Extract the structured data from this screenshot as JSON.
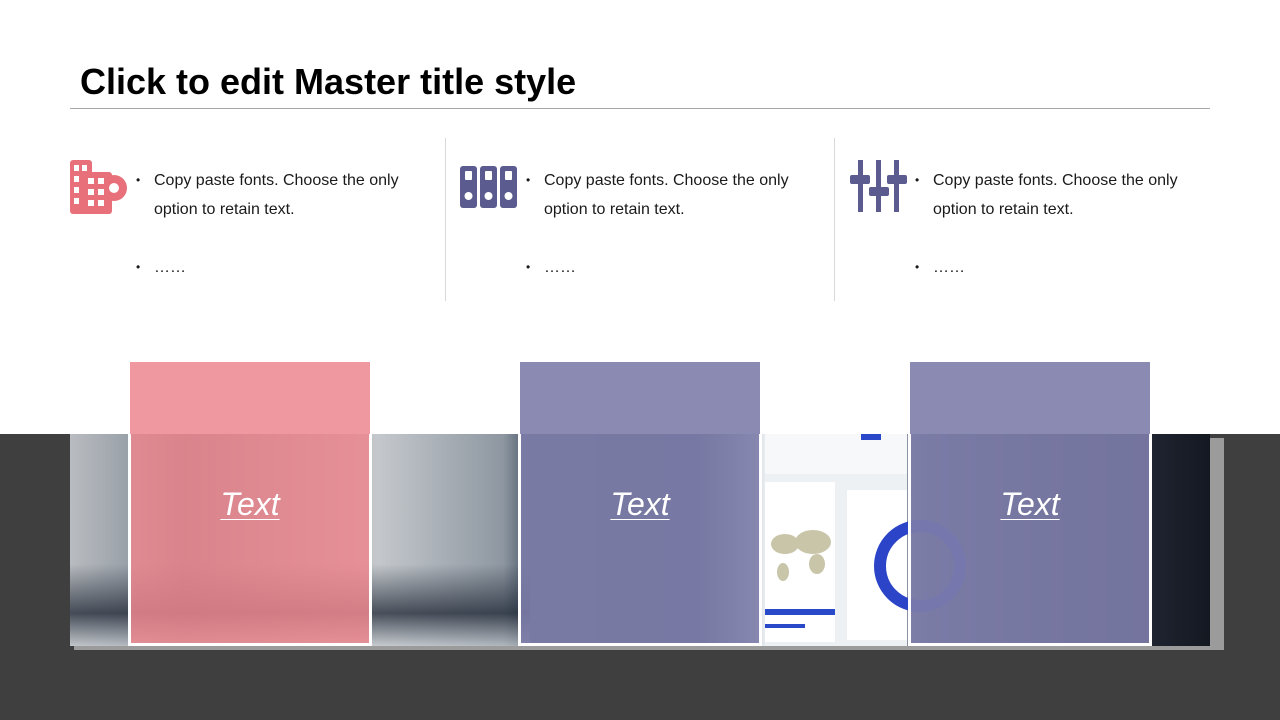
{
  "slide": {
    "title": "Click to edit Master title style"
  },
  "columns": [
    {
      "icon": "office-building-gear-icon",
      "color": "#e8707b",
      "bullet1": "Copy paste fonts. Choose the only option to retain text.",
      "bullet2": "……"
    },
    {
      "icon": "binders-icon",
      "color": "#5b5b8f",
      "bullet1": "Copy paste fonts. Choose the only option to retain text.",
      "bullet2": "……"
    },
    {
      "icon": "equalizer-sliders-icon",
      "color": "#5b5b8f",
      "bullet1": "Copy paste fonts. Choose the only option to retain text.",
      "bullet2": "……"
    }
  ],
  "cards": [
    {
      "label": "Text",
      "color": "#ec868e"
    },
    {
      "label": "Text",
      "color": "#7d7daa"
    },
    {
      "label": "Text",
      "color": "#7d7daa"
    }
  ],
  "colors": {
    "accent_red": "#e8707b",
    "accent_purple": "#5b5b8f",
    "band_dark": "#3f3f3f"
  }
}
